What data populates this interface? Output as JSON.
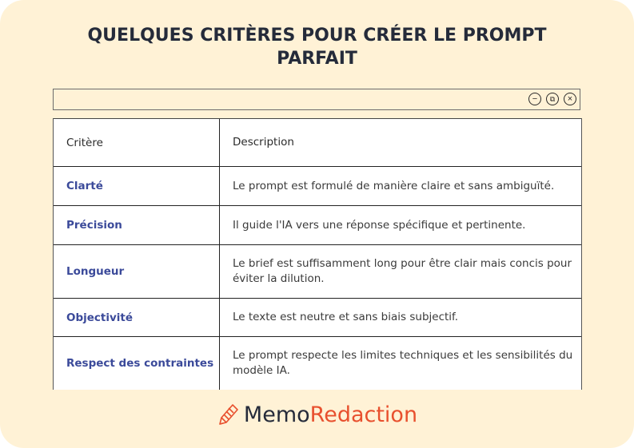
{
  "title": "QUELQUES CRITÈRES POUR CRÉER LE PROMPT PARFAIT",
  "window": {
    "buttons": [
      {
        "name": "minimize",
        "icon": "minus-circle-icon",
        "glyph": "−"
      },
      {
        "name": "restore",
        "icon": "restore-circle-icon",
        "glyph": "⧉"
      },
      {
        "name": "close",
        "icon": "close-circle-icon",
        "glyph": "×"
      }
    ]
  },
  "table": {
    "headers": [
      "Critère",
      "Description"
    ],
    "rows": [
      {
        "criterion": "Clarté",
        "description": "Le prompt est formulé de manière claire et sans ambiguïté."
      },
      {
        "criterion": "Précision",
        "description": "Il guide l'IA vers une réponse spécifique et pertinente."
      },
      {
        "criterion": "Longueur",
        "description": "Le brief est suffisamment long pour être clair mais concis pour éviter la dilution."
      },
      {
        "criterion": "Objectivité",
        "description": "Le texte est neutre et sans biais subjectif."
      },
      {
        "criterion": "Respect des contraintes",
        "description": "Le prompt respecte les limites techniques et les sensibilités du modèle IA."
      }
    ]
  },
  "brand": {
    "part1": "Memo",
    "part2": "Redaction",
    "icon": "pencil-logo-icon"
  },
  "colors": {
    "background": "#fff2d6",
    "accent": "#e8502e",
    "criterion": "#3b4a9a",
    "title": "#252b3a"
  }
}
